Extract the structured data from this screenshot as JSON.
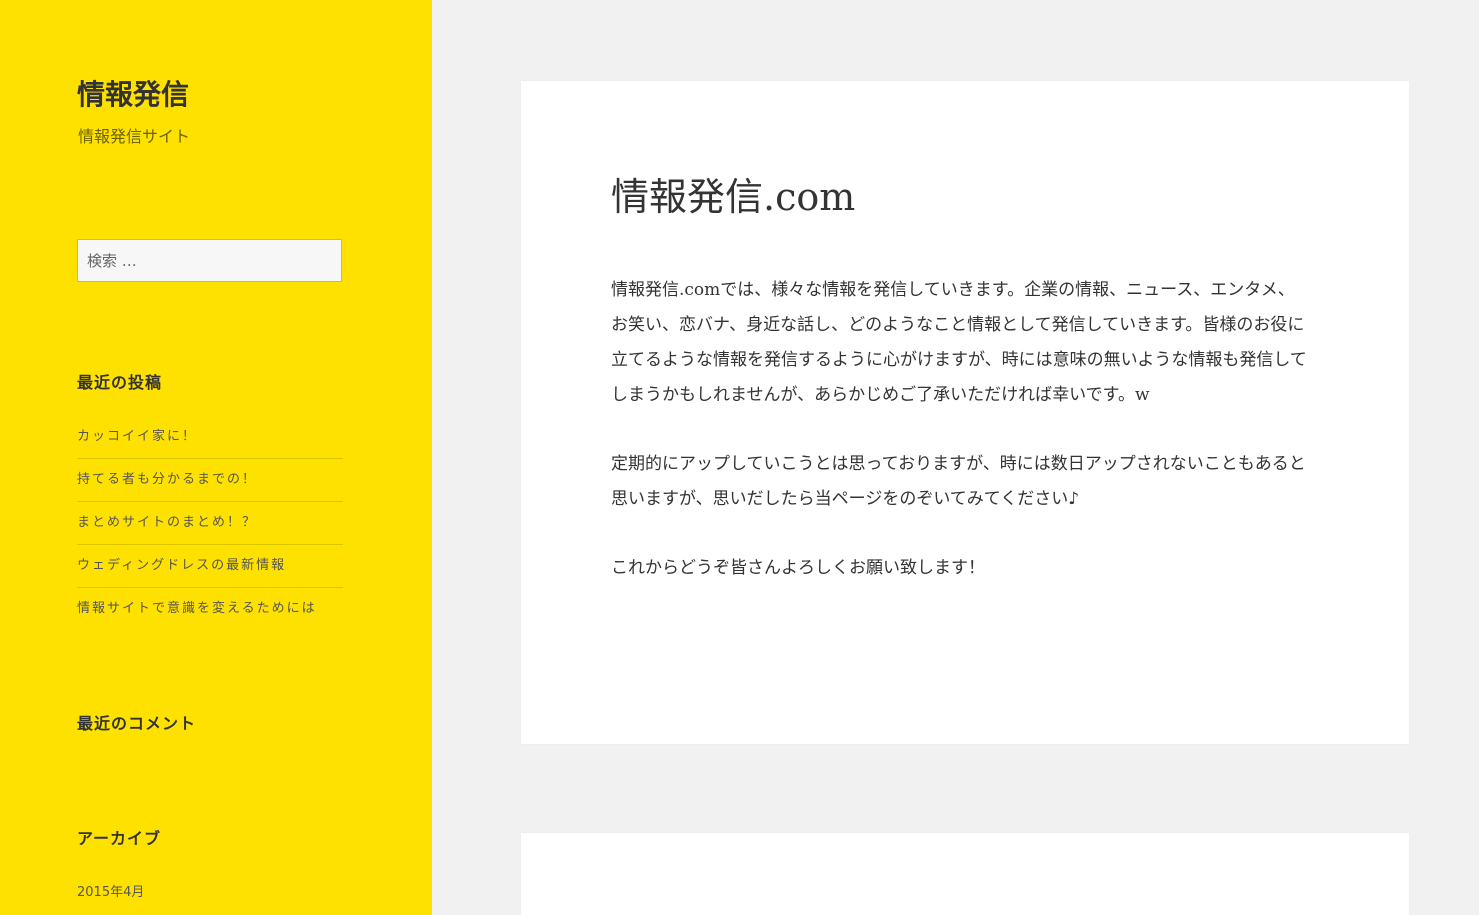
{
  "site": {
    "title": "情報発信",
    "description": "情報発信サイト"
  },
  "search": {
    "placeholder": "検索 …"
  },
  "widgets": {
    "recent_posts": {
      "title": "最近の投稿",
      "items": [
        "カッコイイ家に！",
        "持てる者も分かるまでの！",
        "まとめサイトのまとめ！？",
        "ウェディングドレスの最新情報",
        "情報サイトで意識を変えるためには"
      ]
    },
    "recent_comments": {
      "title": "最近のコメント"
    },
    "archives": {
      "title": "アーカイブ",
      "items": [
        "2015年4月"
      ]
    }
  },
  "post": {
    "title": "情報発信.com",
    "paragraphs": [
      "情報発信.comでは、様々な情報を発信していきます。企業の情報、ニュース、エンタメ、お笑い、恋バナ、身近な話し、どのようなこと情報として発信していきます。皆様のお役に立てるような情報を発信するように心がけますが、時には意味の無いような情報も発信してしまうかもしれませんが、あらかじめご了承いただければ幸いです。w",
      "定期的にアップしていこうとは思っておりますが、時には数日アップされないこともあると思いますが、思いだしたら当ページをのぞいてみてください♪",
      "これからどうぞ皆さんよろしくお願い致します！"
    ]
  }
}
